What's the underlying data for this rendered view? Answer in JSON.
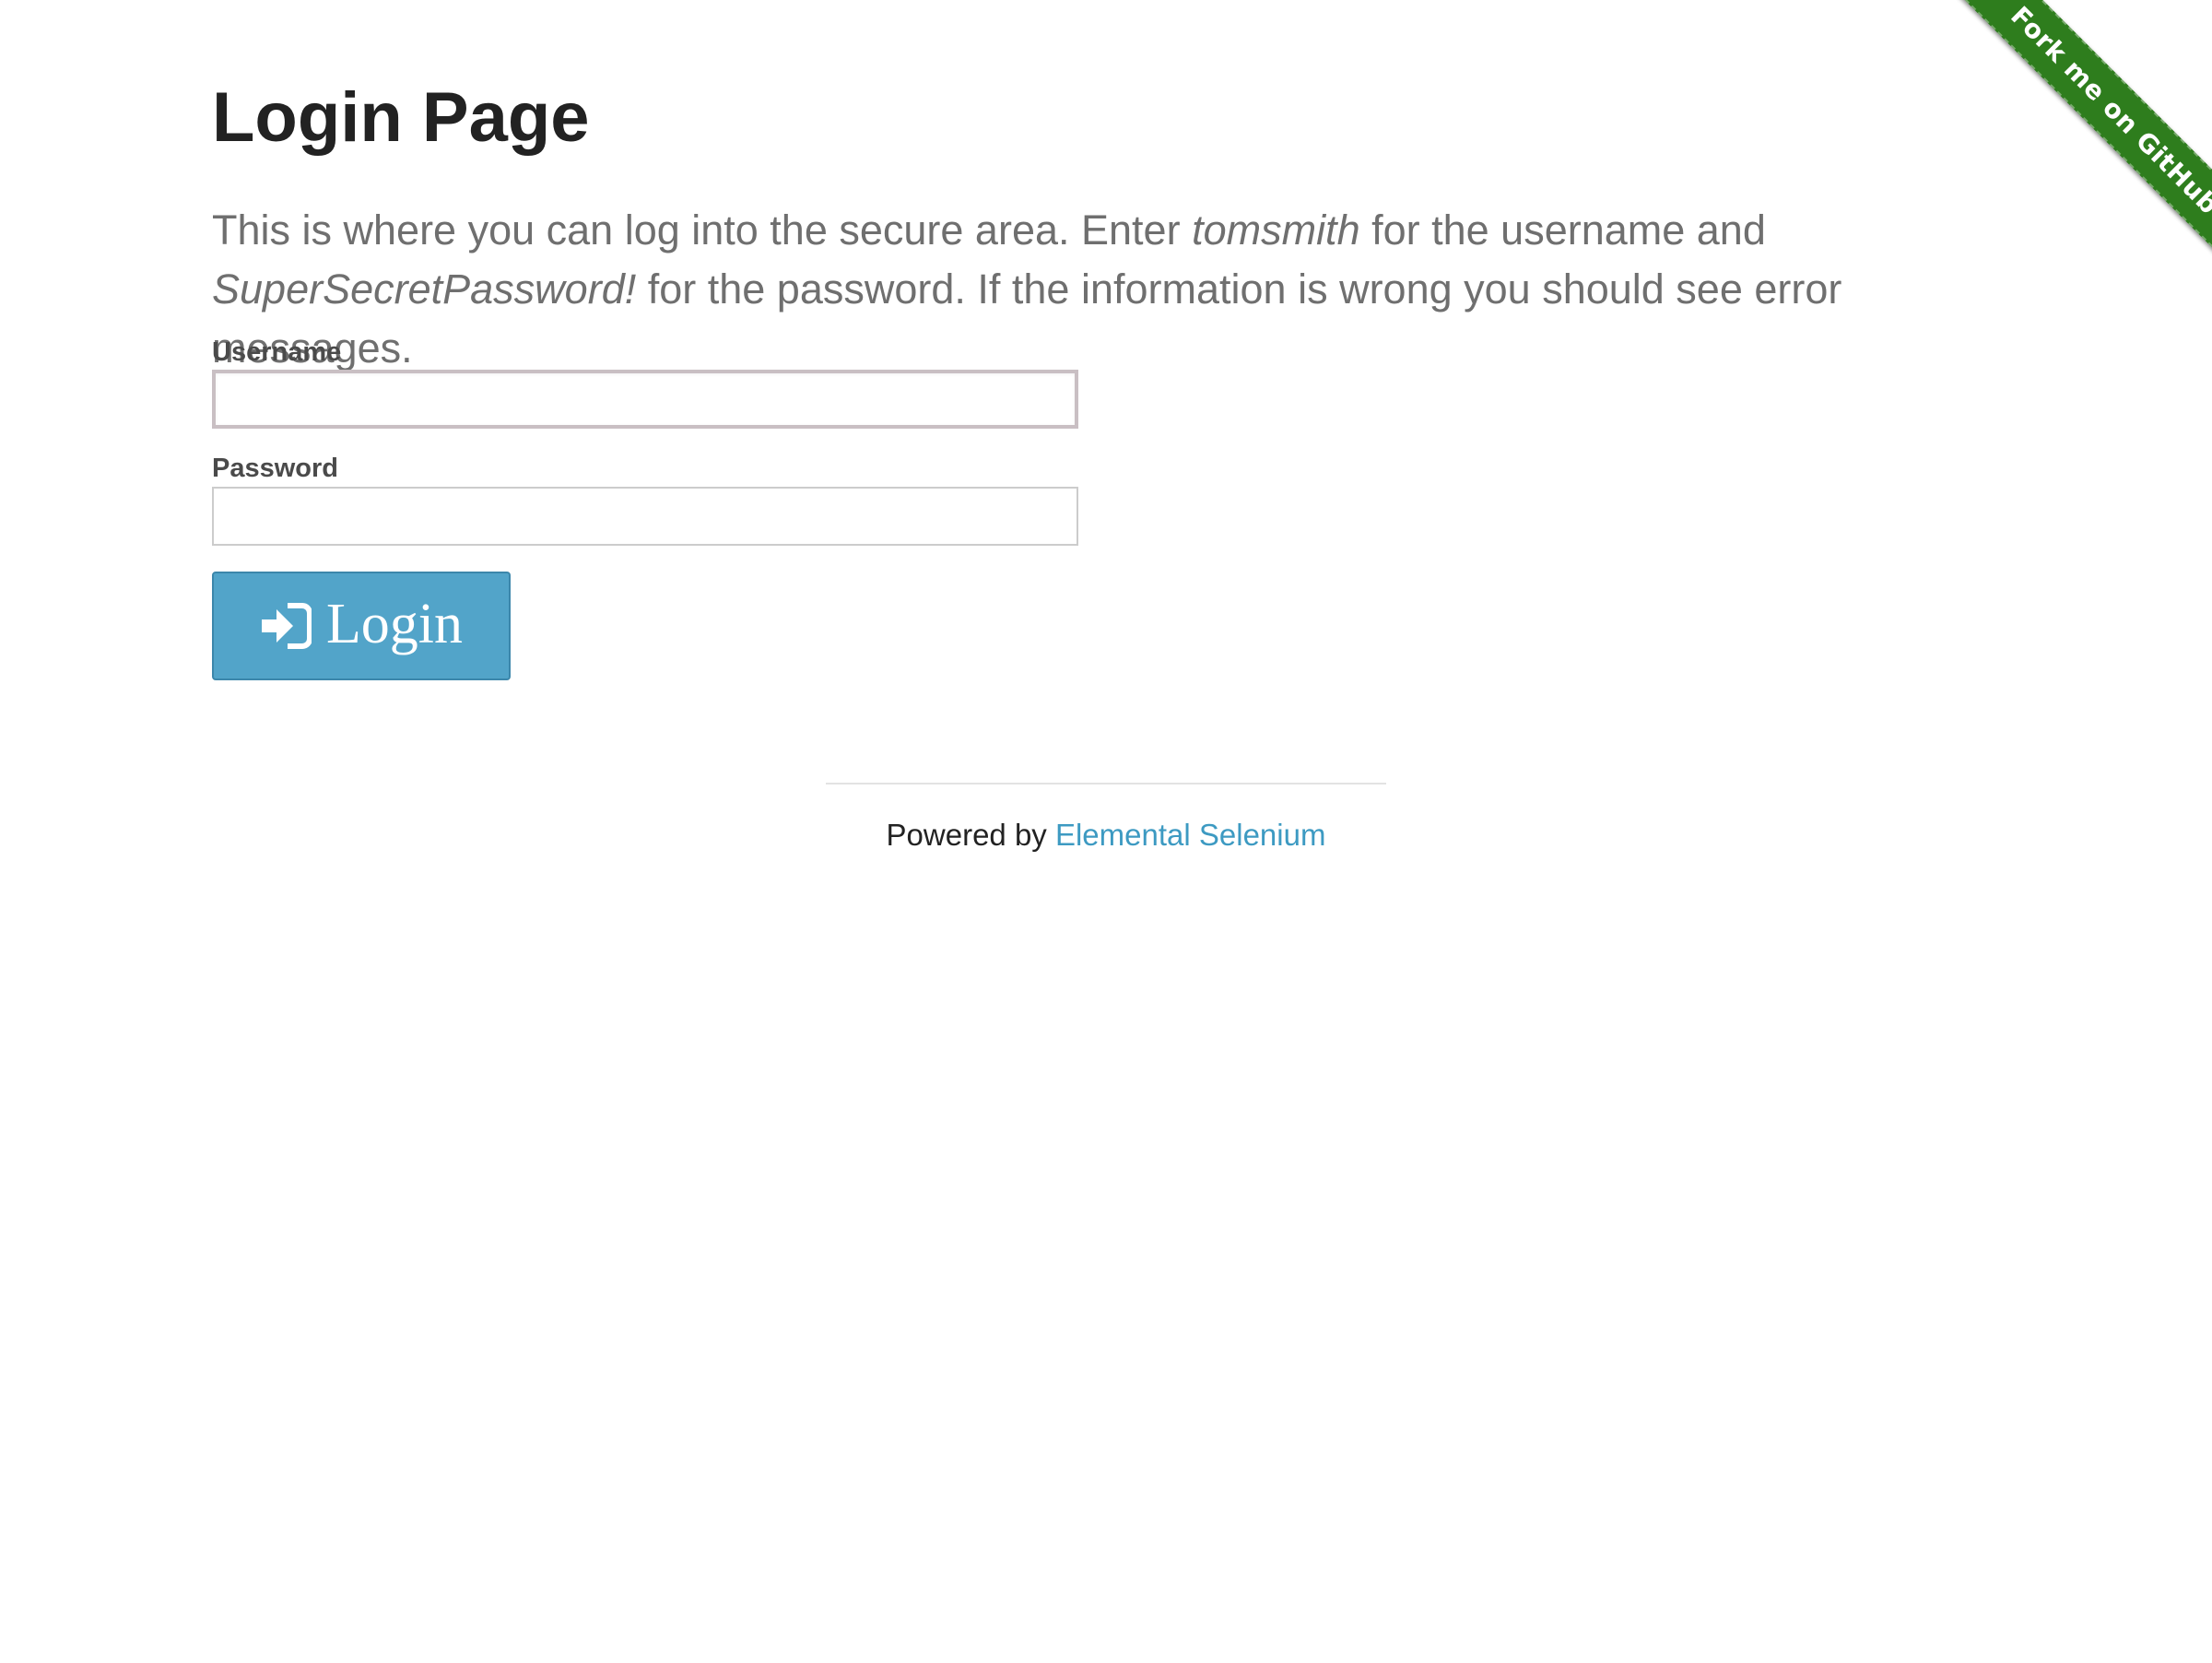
{
  "ribbon": {
    "label": "Fork me on GitHub",
    "color": "#2e7d1d"
  },
  "page": {
    "title": "Login Page",
    "intro": {
      "part1": "This is where you can log into the secure area. Enter ",
      "username_hint": "tomsmith",
      "part2": " for the username and ",
      "password_hint": "SuperSecretPassword!",
      "part3": " for the password. If the information is wrong you should see error messages."
    }
  },
  "form": {
    "username_label": "Username",
    "username_value": "",
    "password_label": "Password",
    "password_value": "",
    "login_label": "Login",
    "login_icon": "sign-in-icon",
    "button_color": "#52a4c9"
  },
  "footer": {
    "powered_by": "Powered by ",
    "link_text": "Elemental Selenium",
    "link_color": "#3d9ac2"
  }
}
